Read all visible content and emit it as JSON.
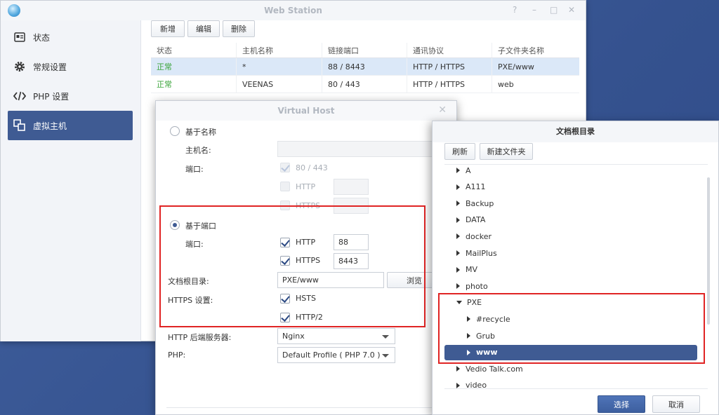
{
  "web_station": {
    "title": "Web Station",
    "controls": [
      "?",
      "–",
      "□",
      "✕"
    ],
    "sidebar": [
      {
        "label": "状态",
        "icon": "status-card-icon",
        "active": false
      },
      {
        "label": "常规设置",
        "icon": "gear-icon",
        "active": false
      },
      {
        "label": "PHP 设置",
        "icon": "code-brackets-icon",
        "active": false
      },
      {
        "label": "虚拟主机",
        "icon": "virtual-host-icon",
        "active": true
      }
    ],
    "toolbar": {
      "add": "新增",
      "edit": "编辑",
      "delete": "删除"
    },
    "grid": {
      "headers": [
        "状态",
        "主机名称",
        "链接端口",
        "通讯协议",
        "子文件夹名称"
      ],
      "rows": [
        [
          "正常",
          "*",
          "88 / 8443",
          "HTTP / HTTPS",
          "PXE/www"
        ],
        [
          "正常",
          "VEENAS",
          "80 / 443",
          "HTTP / HTTPS",
          "web"
        ]
      ]
    }
  },
  "virtual_host": {
    "title": "Virtual Host",
    "by_name": {
      "radio_label": "基于名称",
      "host_label": "主机名:",
      "port_label": "端口:",
      "default_port": "80 / 443",
      "http": "HTTP",
      "https": "HTTPS"
    },
    "by_port": {
      "radio_label": "基于端口",
      "port_label": "端口:",
      "http": "HTTP",
      "http_port": "88",
      "https": "HTTPS",
      "https_port": "8443"
    },
    "doc_root_label": "文档根目录:",
    "doc_root_value": "PXE/www",
    "browse": "浏览",
    "https_settings_label": "HTTPS 设置:",
    "hsts": "HSTS",
    "http2": "HTTP/2",
    "backend_label": "HTTP 后端服务器:",
    "backend_value": "Nginx",
    "php_label": "PHP:",
    "php_value": "Default Profile ( PHP 7.0 )"
  },
  "doc_root_dialog": {
    "title": "文档根目录",
    "refresh": "刷新",
    "new_folder": "新建文件夹",
    "tree": [
      {
        "label": "A",
        "expanded": false,
        "level": 0
      },
      {
        "label": "A111",
        "expanded": false,
        "level": 0
      },
      {
        "label": "Backup",
        "expanded": false,
        "level": 0
      },
      {
        "label": "DATA",
        "expanded": false,
        "level": 0
      },
      {
        "label": "docker",
        "expanded": false,
        "level": 0
      },
      {
        "label": "MailPlus",
        "expanded": false,
        "level": 0
      },
      {
        "label": "MV",
        "expanded": false,
        "level": 0
      },
      {
        "label": "photo",
        "expanded": false,
        "level": 0
      },
      {
        "label": "PXE",
        "expanded": true,
        "level": 0
      },
      {
        "label": "#recycle",
        "expanded": false,
        "level": 1
      },
      {
        "label": "Grub",
        "expanded": false,
        "level": 1
      },
      {
        "label": "www",
        "expanded": false,
        "level": 1,
        "selected": true
      },
      {
        "label": "Vedio Talk.com",
        "expanded": false,
        "level": 0
      },
      {
        "label": "video",
        "expanded": false,
        "level": 0
      }
    ],
    "ok": "选择",
    "cancel": "取消"
  },
  "colors": {
    "accent": "#3f5b93",
    "highlight": "#e02424",
    "status_ok": "#3aa43a"
  }
}
